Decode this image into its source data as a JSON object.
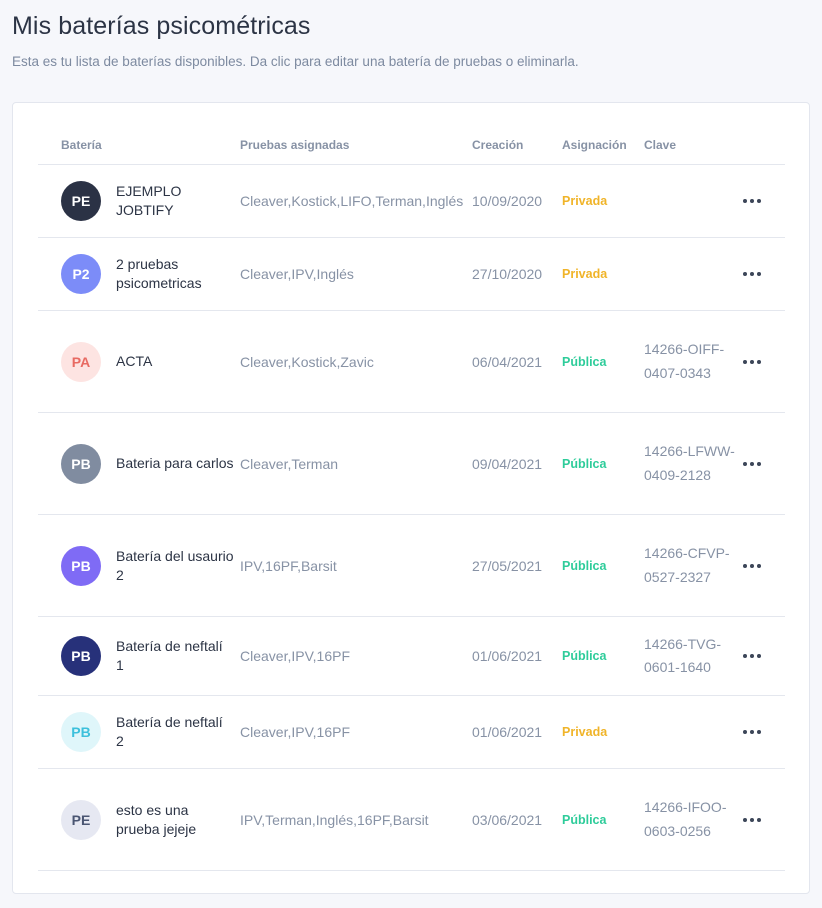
{
  "header": {
    "title": "Mis baterías psicométricas",
    "subtitle": "Esta es tu lista de baterías disponibles. Da clic para editar una batería de pruebas o eliminarla."
  },
  "table": {
    "columns": [
      "Batería",
      "Pruebas asignadas",
      "Creación",
      "Asignación",
      "Clave"
    ],
    "rows": [
      {
        "initials": "PE",
        "name": "EJEMPLO JOBTIFY",
        "tests": "Cleaver,Kostick,LIFO,Terman,Inglés",
        "created": "10/09/2020",
        "assignment": "Privada",
        "key": ""
      },
      {
        "initials": "P2",
        "name": "2 pruebas psicometricas",
        "tests": "Cleaver,IPV,Inglés",
        "created": "27/10/2020",
        "assignment": "Privada",
        "key": ""
      },
      {
        "initials": "PA",
        "name": "ACTA",
        "tests": "Cleaver,Kostick,Zavic",
        "created": "06/04/2021",
        "assignment": "Pública",
        "key": "14266-OIFF-0407-0343"
      },
      {
        "initials": "PB",
        "name": "Bateria para carlos",
        "tests": "Cleaver,Terman",
        "created": "09/04/2021",
        "assignment": "Pública",
        "key": "14266-LFWW-0409-2128"
      },
      {
        "initials": "PB",
        "name": "Batería del usaurio 2",
        "tests": "IPV,16PF,Barsit",
        "created": "27/05/2021",
        "assignment": "Pública",
        "key": "14266-CFVP-0527-2327"
      },
      {
        "initials": "PB",
        "name": "Batería de neftalí 1",
        "tests": "Cleaver,IPV,16PF",
        "created": "01/06/2021",
        "assignment": "Pública",
        "key": "14266-TVG-0601-1640"
      },
      {
        "initials": "PB",
        "name": "Batería de neftalí 2",
        "tests": "Cleaver,IPV,16PF",
        "created": "01/06/2021",
        "assignment": "Privada",
        "key": ""
      },
      {
        "initials": "PE",
        "name": "esto es una prueba jejeje",
        "tests": "IPV,Terman,Inglés,16PF,Barsit",
        "created": "03/06/2021",
        "assignment": "Pública",
        "key": "14266-IFOO-0603-0256"
      }
    ]
  },
  "colors": {
    "avatars": [
      {
        "bg": "#2b3245",
        "fg": "#ffffff"
      },
      {
        "bg": "#7c8cf8",
        "fg": "#ffffff"
      },
      {
        "bg": "#fde4e2",
        "fg": "#e86a62"
      },
      {
        "bg": "#808ca0",
        "fg": "#ffffff"
      },
      {
        "bg": "#7f6bf5",
        "fg": "#ffffff"
      },
      {
        "bg": "#27317a",
        "fg": "#ffffff"
      },
      {
        "bg": "#dff6fa",
        "fg": "#3cc0dc"
      },
      {
        "bg": "#e6e8f2",
        "fg": "#4a5572"
      }
    ],
    "private": "#f0b429",
    "public": "#2ecc9a"
  }
}
